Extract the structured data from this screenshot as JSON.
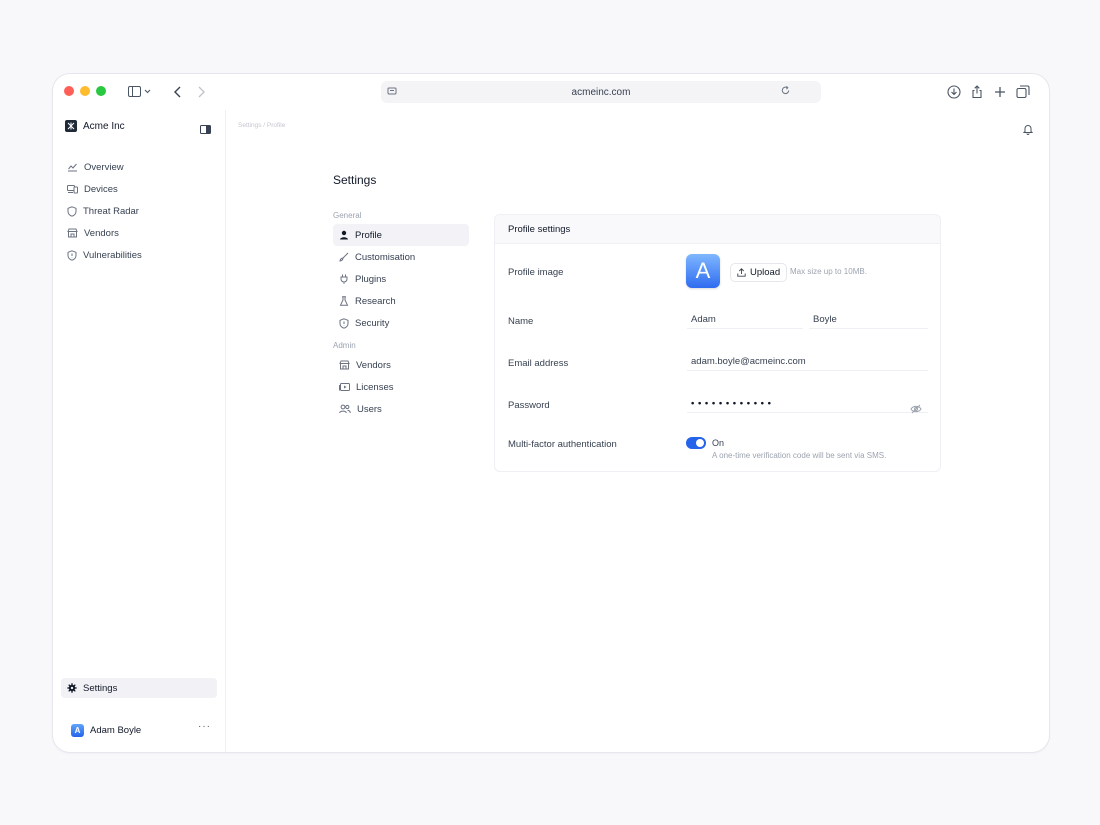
{
  "browser": {
    "url": "acmeinc.com"
  },
  "sidebar": {
    "brand": "Acme Inc",
    "items": [
      {
        "label": "Overview",
        "icon": "chart-icon"
      },
      {
        "label": "Devices",
        "icon": "devices-icon"
      },
      {
        "label": "Threat Radar",
        "icon": "shield-icon"
      },
      {
        "label": "Vendors",
        "icon": "store-icon"
      },
      {
        "label": "Vulnerabilities",
        "icon": "shield-icon"
      }
    ],
    "settings_label": "Settings",
    "user": {
      "initial": "A",
      "name": "Adam Boyle",
      "more": "···"
    }
  },
  "breadcrumb": "Settings / Profile",
  "page_title": "Settings",
  "subnav": {
    "general_label": "General",
    "general_items": [
      {
        "label": "Profile",
        "icon": "person-icon",
        "active": true
      },
      {
        "label": "Customisation",
        "icon": "brush-icon"
      },
      {
        "label": "Plugins",
        "icon": "plug-icon"
      },
      {
        "label": "Research",
        "icon": "flask-icon"
      },
      {
        "label": "Security",
        "icon": "shield-icon"
      }
    ],
    "admin_label": "Admin",
    "admin_items": [
      {
        "label": "Vendors",
        "icon": "store-icon"
      },
      {
        "label": "Licenses",
        "icon": "license-icon"
      },
      {
        "label": "Users",
        "icon": "users-icon"
      }
    ]
  },
  "profile": {
    "header": "Profile settings",
    "image_label": "Profile image",
    "avatar_initial": "A",
    "upload_label": "Upload",
    "upload_hint": "Max size up to 10MB.",
    "name_label": "Name",
    "first_name": "Adam",
    "last_name": "Boyle",
    "email_label": "Email address",
    "email": "adam.boyle@acmeinc.com",
    "password_label": "Password",
    "password_mask": "• • • • • • • • • • • •",
    "mfa_label": "Multi-factor authentication",
    "mfa_state": "On",
    "mfa_enabled": true,
    "mfa_hint": "A one-time verification code will be sent via SMS."
  },
  "colors": {
    "accent": "#2563eb",
    "traffic_red": "#ff5f57",
    "traffic_yellow": "#febc2e",
    "traffic_green": "#28c840"
  }
}
